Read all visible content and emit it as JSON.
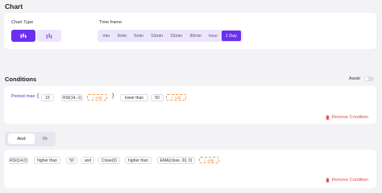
{
  "chart_section": {
    "title": "Chart",
    "chart_type_label": "Chart Type",
    "time_frame_label": "Time frame",
    "time_frames": [
      "min",
      "3min",
      "5min",
      "10min",
      "15min",
      "30min",
      "hour",
      "1 Day"
    ],
    "selected_time_frame": "1 Day"
  },
  "conditions_section": {
    "title": "Conditions",
    "assist_label": "Assist",
    "assist_enabled": false,
    "condition1": {
      "label": "Period max",
      "open_paren": "(",
      "value": "15",
      "indicator": "RSI(14,-1)",
      "add_label": "+ Add",
      "close_paren": ")",
      "operator": "lower than",
      "threshold": "50",
      "add_label2": "+ Add",
      "remove_label": "Remove Condition"
    },
    "logic": {
      "and_label": "And",
      "or_label": "Or",
      "selected": "And"
    },
    "condition2": {
      "items": [
        "RSI(14,0)",
        "higher than",
        "50",
        "and",
        "Close(0)",
        "higher than",
        "EMA(close, 20, 0)"
      ],
      "add_label": "+ Add",
      "remove_label": "Remove Condition"
    }
  },
  "colors": {
    "accent": "#6a2ff0",
    "accent_light": "#ece6fb",
    "danger": "#e5484d",
    "add_orange": "#f2994a"
  }
}
